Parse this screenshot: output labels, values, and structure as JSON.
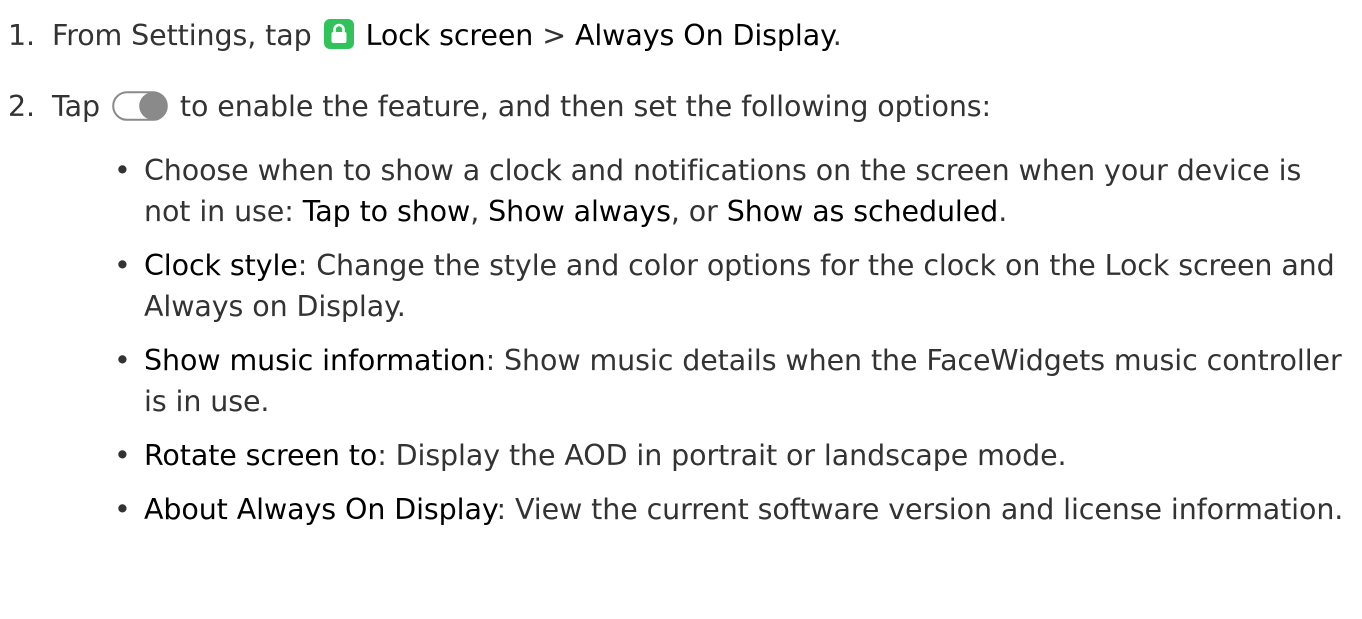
{
  "steps": [
    {
      "number": "1.",
      "text_before": "From Settings, tap",
      "icon": "lock-icon",
      "icon_color": "#2fc35a",
      "link1": "Lock screen",
      "separator": ">",
      "link2": "Always On Display",
      "text_after": "."
    },
    {
      "number": "2.",
      "text_before": "Tap",
      "icon": "toggle-icon",
      "text_after": "to enable the feature, and then set the following options:"
    }
  ],
  "bullets": [
    {
      "parts": [
        {
          "text": "Choose when to show a clock and notifications on the screen when your device is not in use: ",
          "emphasis": false
        },
        {
          "text": "Tap to show",
          "emphasis": true
        },
        {
          "text": ", ",
          "emphasis": false
        },
        {
          "text": "Show always",
          "emphasis": true
        },
        {
          "text": ", or ",
          "emphasis": false
        },
        {
          "text": "Show as scheduled",
          "emphasis": true
        },
        {
          "text": ".",
          "emphasis": false
        }
      ]
    },
    {
      "parts": [
        {
          "text": "Clock style",
          "emphasis": true
        },
        {
          "text": ": Change the style and color options for the clock on the Lock screen and Always on Display.",
          "emphasis": false
        }
      ]
    },
    {
      "parts": [
        {
          "text": "Show music information",
          "emphasis": true
        },
        {
          "text": ": Show music details when the FaceWidgets music controller is in use.",
          "emphasis": false
        }
      ]
    },
    {
      "parts": [
        {
          "text": "Rotate screen to",
          "emphasis": true
        },
        {
          "text": ": Display the AOD in portrait or landscape mode.",
          "emphasis": false
        }
      ]
    },
    {
      "parts": [
        {
          "text": "About Always On Display",
          "emphasis": true
        },
        {
          "text": ": View the current software version and license information.",
          "emphasis": false
        }
      ]
    }
  ],
  "bullet_glyph": "•"
}
